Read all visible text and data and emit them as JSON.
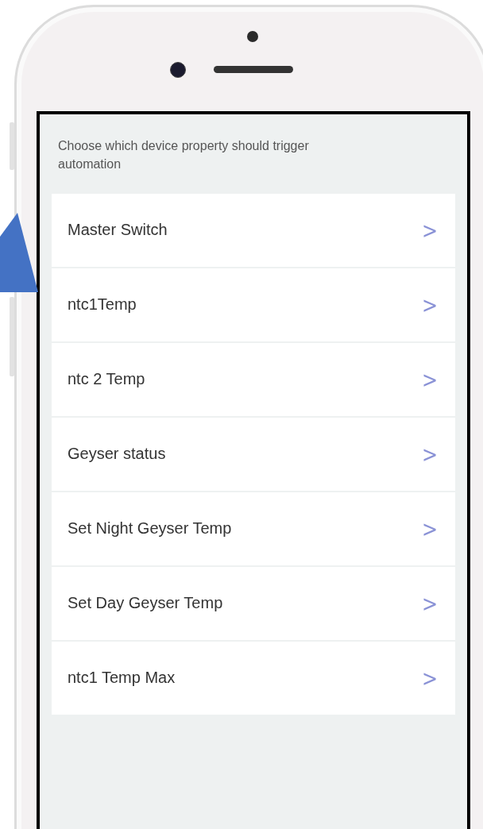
{
  "screen": {
    "heading": "Choose which device property should trigger automation",
    "properties": [
      {
        "label": "Master Switch",
        "chevron": ">"
      },
      {
        "label": "ntc1Temp",
        "chevron": ">"
      },
      {
        "label": "ntc 2 Temp",
        "chevron": ">"
      },
      {
        "label": "Geyser status",
        "chevron": ">"
      },
      {
        "label": "Set Night Geyser Temp",
        "chevron": ">"
      },
      {
        "label": "Set Day Geyser Temp",
        "chevron": ">"
      },
      {
        "label": "ntc1 Temp Max",
        "chevron": ">"
      }
    ]
  }
}
